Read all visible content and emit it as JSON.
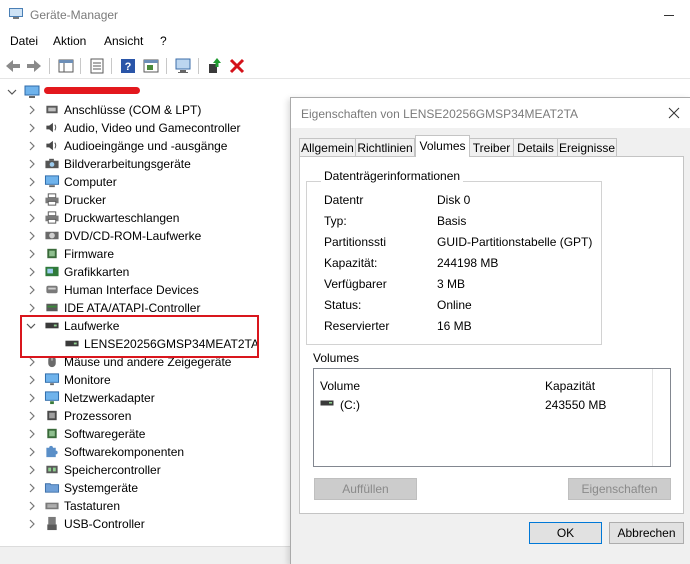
{
  "window": {
    "title": "Geräte-Manager"
  },
  "menu": {
    "items": [
      "Datei",
      "Aktion",
      "Ansicht",
      "?"
    ]
  },
  "tree": {
    "categories": [
      {
        "label": "Anschlüsse (COM & LPT)",
        "icon": "port-icon"
      },
      {
        "label": "Audio, Video und Gamecontroller",
        "icon": "speaker-icon"
      },
      {
        "label": "Audioeingänge und -ausgänge",
        "icon": "speaker-icon"
      },
      {
        "label": "Bildverarbeitungsgeräte",
        "icon": "camera-icon"
      },
      {
        "label": "Computer",
        "icon": "computer-icon"
      },
      {
        "label": "Drucker",
        "icon": "printer-icon"
      },
      {
        "label": "Druckwarteschlangen",
        "icon": "printer-icon"
      },
      {
        "label": "DVD/CD-ROM-Laufwerke",
        "icon": "disc-icon"
      },
      {
        "label": "Firmware",
        "icon": "chip-icon"
      },
      {
        "label": "Grafikkarten",
        "icon": "display-adapter-icon"
      },
      {
        "label": "Human Interface Devices",
        "icon": "hid-icon"
      },
      {
        "label": "IDE ATA/ATAPI-Controller",
        "icon": "controller-icon"
      },
      {
        "label": "Laufwerke",
        "icon": "drive-icon"
      },
      {
        "label": "Mäuse und andere Zeigegeräte",
        "icon": "mouse-icon"
      },
      {
        "label": "Monitore",
        "icon": "monitor-icon"
      },
      {
        "label": "Netzwerkadapter",
        "icon": "network-icon"
      },
      {
        "label": "Prozessoren",
        "icon": "cpu-icon"
      },
      {
        "label": "Softwaregeräte",
        "icon": "chip-icon"
      },
      {
        "label": "Softwarekomponenten",
        "icon": "puzzle-icon"
      },
      {
        "label": "Speichercontroller",
        "icon": "storage-controller-icon"
      },
      {
        "label": "Systemgeräte",
        "icon": "folder-icon"
      },
      {
        "label": "Tastaturen",
        "icon": "keyboard-icon"
      },
      {
        "label": "USB-Controller",
        "icon": "usb-icon"
      }
    ],
    "expanded_child": {
      "label": "LENSE20256GMSP34MEAT2TA",
      "icon": "drive-icon"
    }
  },
  "dialog": {
    "title": "Eigenschaften von LENSE20256GMSP34MEAT2TA",
    "tabs": [
      "Allgemein",
      "Richtlinien",
      "Volumes",
      "Treiber",
      "Details",
      "Ereignisse"
    ],
    "active_tab": "Volumes",
    "group_title": "Datenträgerinformationen",
    "properties": [
      {
        "label": "Datentr",
        "value": "Disk 0"
      },
      {
        "label": "Typ:",
        "value": "Basis"
      },
      {
        "label": "Partitionssti",
        "value": "GUID-Partitionstabelle (GPT)"
      },
      {
        "label": "Kapazität:",
        "value": "244198 MB"
      },
      {
        "label": "Verfügbarer",
        "value": "3 MB"
      },
      {
        "label": "Status:",
        "value": "Online"
      },
      {
        "label": "Reservierter",
        "value": "16 MB"
      }
    ],
    "volumes_label": "Volumes",
    "volume_columns": [
      "Volume",
      "Kapazität"
    ],
    "volume_rows": [
      {
        "volume": "(C:)",
        "capacity": "243550 MB"
      }
    ],
    "buttons": {
      "populate": "Auffüllen",
      "properties": "Eigenschaften",
      "ok": "OK",
      "cancel": "Abbrechen"
    }
  },
  "colors": {
    "highlight": "#d9161d",
    "accent": "#0078d7"
  }
}
